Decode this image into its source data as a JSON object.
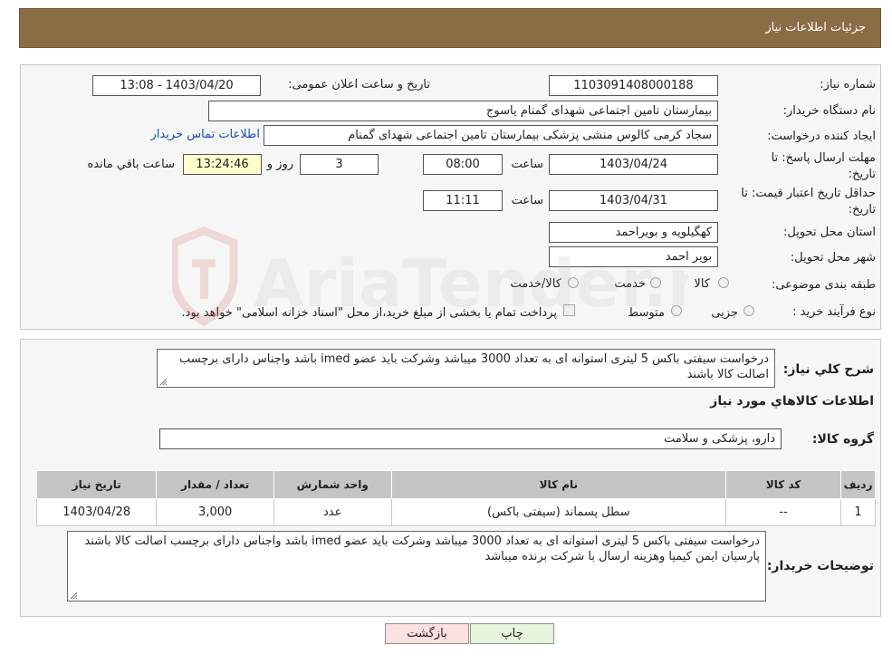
{
  "header": {
    "title": "جزئیات اطلاعات نیاز"
  },
  "need": {
    "number_label": "شماره نیاز:",
    "number_value": "1103091408000188",
    "announce_label": "تاریخ و ساعت اعلان عمومی:",
    "announce_value": "1403/04/20 - 13:08",
    "buyer_label": "نام دستگاه خریدار:",
    "buyer_value": "بیمارستان تامین اجتماعی شهدای گمنام یاسوج",
    "creator_label": "ایجاد کننده درخواست:",
    "creator_value": "سجاد کرمی کالوس  منشی پزشکی  بیمارستان تامین اجتماعی شهدای گمنام",
    "contact_link": "اطلاعات تماس خریدار",
    "deadline_label_1": "مهلت ارسال پاسخ: تا",
    "deadline_label_2": "تاریخ:",
    "deadline_date": "1403/04/24",
    "time_label": "ساعت",
    "deadline_time": "08:00",
    "days_value": "3",
    "days_label": "روز و",
    "remaining_time": "13:24:46",
    "remaining_label": "ساعت باقي مانده",
    "validity_label_1": "حداقل تاریخ اعتبار قیمت: تا",
    "validity_label_2": "تاریخ:",
    "validity_date": "1403/04/31",
    "validity_time": "11:11",
    "province_label": "استان محل تحویل:",
    "province_value": "کهگیلویه و بویراحمد",
    "city_label": "شهر محل تحویل:",
    "city_value": "بویر احمد",
    "category_label": "طبقه بندی موضوعی:",
    "category_options": [
      "کالا",
      "خدمت",
      "کالا/خدمت"
    ],
    "process_label": "نوع فرآیند خرید :",
    "process_options": [
      "جزیی",
      "متوسط"
    ],
    "process_note": "پرداخت تمام یا بخشی از مبلغ خرید،از محل \"اسناد خزانه اسلامی\" خواهد بود."
  },
  "details": {
    "summary_label": "شرح کلي نياز:",
    "summary_text": "درخواست سیفتی باکس 5 لیتری استوانه ای به تعداد 3000 میباشد وشرکت باید عضو imed باشد واجناس دارای برچسب اصالت کالا باشند",
    "goods_info_title": "اطلاعات کالاهاي مورد نياز",
    "group_label": "گروه کالا:",
    "group_value": "دارو، پزشکی و سلامت",
    "table": {
      "headers": [
        "ردیف",
        "کد کالا",
        "نام کالا",
        "واحد شمارش",
        "تعداد / مقدار",
        "تاریخ نیاز"
      ],
      "rows": [
        [
          "1",
          "--",
          "سطل پسماند (سیفتی باکس)",
          "عدد",
          "3,000",
          "1403/04/28"
        ]
      ]
    },
    "buyer_notes_label": "توضیحات خریدار:",
    "buyer_notes_text": "درخواست سیفتی باکس 5 لیتری استوانه ای به تعداد 3000 میباشد وشرکت باید عضو imed باشد واجناس دارای برچسب اصالت کالا باشند  پارسیان ایمن کیمیا وهزینه ارسال با شرکت برنده میباشد"
  },
  "buttons": {
    "print": "چاپ",
    "back": "بازگشت"
  },
  "watermark": {
    "text": "AriaTender.neT"
  },
  "colors": {
    "header": "#8b6d45",
    "link": "#1a4db3",
    "remaining_bg": "#fefccc",
    "back_bg": "#fde0e0",
    "print_bg": "#e5f5dd"
  }
}
